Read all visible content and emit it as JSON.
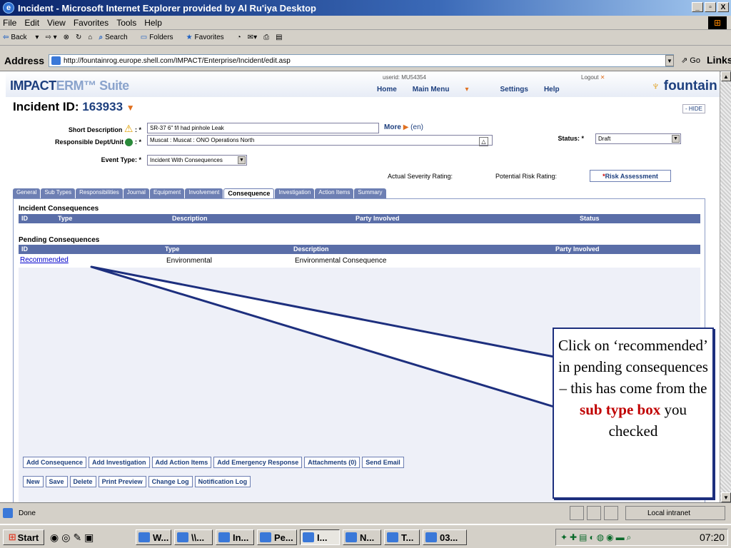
{
  "window": {
    "title": "Incident - Microsoft Internet Explorer provided by Al Ru'iya Desktop",
    "controls": [
      "_",
      "▫",
      "X"
    ]
  },
  "menu": [
    "File",
    "Edit",
    "View",
    "Favorites",
    "Tools",
    "Help"
  ],
  "toolbar": {
    "back": "Back",
    "search": "Search",
    "folders": "Folders",
    "favorites": "Favorites"
  },
  "address": {
    "label": "Address",
    "url": "http://fountainrog.europe.shell.com/IMPACT/Enterprise/Incident/edit.asp",
    "go": "Go",
    "links": "Links"
  },
  "app": {
    "logo_main": "IMPACT",
    "logo_sub": "ERM™ Suite",
    "userid": "userid: MU54354",
    "logout": "Logout",
    "nav": [
      "Home",
      "Main Menu",
      "Settings",
      "Help"
    ],
    "brand": "fountain"
  },
  "incident": {
    "label": "Incident ID:",
    "id": "163933",
    "hide": "- HIDE",
    "short_desc_label": "Short Description",
    "short_desc_value": "SR-37 6\" f/l had pinhole Leak",
    "more": "More",
    "lang": "(en)",
    "dept_label": "Responsible Dept/Unit",
    "dept_value": "Muscat : Muscat : ONO Operations North",
    "status_label": "Status:",
    "status_value": "Draft",
    "event_label": "Event Type:",
    "event_value": "Incident With Consequences",
    "actual_sev": "Actual Severity Rating:",
    "potential_risk": "Potential Risk Rating:",
    "risk_btn": "Risk Assessment",
    "req": "*"
  },
  "tabs": [
    "General",
    "Sub Types",
    "Responsibilities",
    "Journal",
    "Equipment",
    "Involvement",
    "Consequence",
    "Investigation",
    "Action Items",
    "Summary"
  ],
  "active_tab": "Consequence",
  "incident_consequences": {
    "title": "Incident Consequences",
    "headers": [
      "ID",
      "Type",
      "Description",
      "Party Involved",
      "Status"
    ]
  },
  "pending_consequences": {
    "title": "Pending Consequences",
    "headers": [
      "ID",
      "Type",
      "Description",
      "Party Involved"
    ],
    "rows": [
      {
        "id": "Recommended",
        "type": "Environmental",
        "description": "Environmental Consequence"
      }
    ]
  },
  "buttons_row1": [
    "Add Consequence",
    "Add Investigation",
    "Add Action Items",
    "Add Emergency Response",
    "Attachments (0)",
    "Send Email"
  ],
  "buttons_row2": [
    "New",
    "Save",
    "Delete",
    "Print Preview",
    "Change Log",
    "Notification Log"
  ],
  "callout": {
    "text_a": "Click on ‘recommended’ in pending consequences – this has come from the",
    "highlight": "sub type box",
    "text_b": "you checked",
    "highlight_color": "#c00000"
  },
  "statusbar": {
    "status": "Done",
    "zone": "Local intranet"
  },
  "taskbar": {
    "start": "Start",
    "tasks": [
      "W...",
      "\\\\...",
      "In...",
      "Pe...",
      "I...",
      "N...",
      "T...",
      "03..."
    ],
    "time": "07:20"
  },
  "colors": {
    "table_header": "#5a6ea8",
    "tab_inactive": "#6d7fb3",
    "brand_blue": "#1d3f7e",
    "accent_orange": "#e07020"
  }
}
